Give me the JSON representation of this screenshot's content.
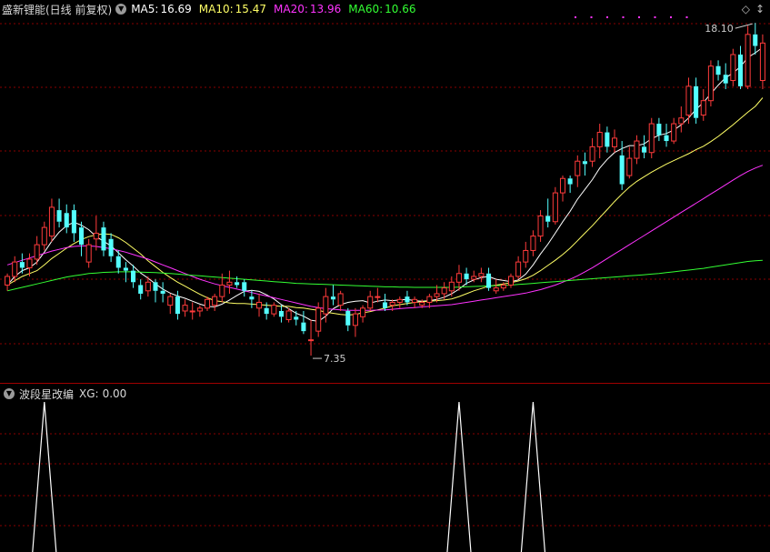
{
  "header": {
    "title": "盛新锂能(日线 前复权)",
    "ma_items": [
      {
        "label": "MA5:",
        "value": "16.69",
        "color": "#ffffff"
      },
      {
        "label": "MA10:",
        "value": "15.47",
        "color": "#ffff66"
      },
      {
        "label": "MA20:",
        "value": "13.96",
        "color": "#ff33ff"
      },
      {
        "label": "MA60:",
        "value": "10.66",
        "color": "#33ff33"
      }
    ]
  },
  "indicator_header": {
    "title": "波段星改编",
    "xg_label": "XG:",
    "xg_value": "0.00"
  },
  "icons": {
    "dropdown": "chevron-down-icon",
    "diamond": "diamond-icon",
    "arrow": "arrow-icon"
  },
  "colors": {
    "up": "#ff3b3b",
    "down": "#54ffff",
    "ma5": "#ffffff",
    "ma10": "#ffff66",
    "ma20": "#ff33ff",
    "ma60": "#33ff33",
    "grid": "#8a0000",
    "xg": "#ffffff"
  },
  "chart_data": {
    "type": "candlestick",
    "ylim": [
      6.5,
      19.0
    ],
    "high_label": "18.10",
    "low_label": "7.35",
    "ohlc": [
      [
        9.8,
        10.2,
        9.6,
        10.1
      ],
      [
        10.1,
        10.8,
        9.9,
        10.6
      ],
      [
        10.6,
        10.9,
        10.2,
        10.4
      ],
      [
        10.4,
        10.9,
        10.1,
        10.7
      ],
      [
        10.7,
        11.5,
        10.5,
        11.2
      ],
      [
        11.2,
        12.0,
        11.0,
        11.8
      ],
      [
        11.5,
        12.8,
        11.3,
        12.5
      ],
      [
        12.4,
        12.8,
        11.8,
        12.0
      ],
      [
        12.3,
        12.6,
        11.6,
        11.8
      ],
      [
        12.4,
        12.6,
        11.3,
        11.6
      ],
      [
        11.8,
        12.0,
        10.8,
        11.2
      ],
      [
        10.6,
        11.4,
        10.4,
        11.2
      ],
      [
        11.4,
        12.2,
        11.0,
        11.6
      ],
      [
        11.8,
        12.0,
        10.8,
        11.0
      ],
      [
        11.4,
        11.6,
        10.6,
        10.8
      ],
      [
        10.8,
        11.0,
        10.2,
        10.4
      ],
      [
        10.4,
        10.6,
        9.9,
        10.3
      ],
      [
        10.3,
        10.5,
        9.7,
        9.9
      ],
      [
        9.8,
        10.0,
        9.3,
        9.5
      ],
      [
        9.6,
        10.1,
        9.4,
        9.9
      ],
      [
        9.9,
        10.0,
        9.2,
        9.6
      ],
      [
        9.6,
        9.9,
        9.2,
        9.5
      ],
      [
        9.1,
        9.5,
        8.8,
        9.4
      ],
      [
        9.4,
        9.6,
        8.6,
        8.8
      ],
      [
        8.9,
        9.3,
        8.7,
        9.1
      ],
      [
        8.9,
        9.2,
        8.6,
        8.9
      ],
      [
        8.9,
        9.1,
        8.7,
        9.0
      ],
      [
        9.0,
        9.4,
        8.9,
        9.3
      ],
      [
        9.1,
        9.5,
        8.9,
        9.4
      ],
      [
        9.4,
        10.2,
        9.2,
        9.8
      ],
      [
        9.8,
        10.3,
        9.5,
        9.9
      ],
      [
        9.9,
        10.1,
        9.7,
        9.8
      ],
      [
        9.9,
        10.0,
        9.4,
        9.6
      ],
      [
        9.4,
        9.6,
        9.0,
        9.3
      ],
      [
        9.0,
        9.5,
        8.7,
        9.2
      ],
      [
        9.0,
        9.2,
        8.6,
        8.8
      ],
      [
        8.8,
        9.2,
        8.7,
        9.1
      ],
      [
        8.9,
        9.1,
        8.5,
        8.7
      ],
      [
        8.6,
        9.0,
        8.5,
        8.9
      ],
      [
        8.7,
        8.9,
        8.4,
        8.6
      ],
      [
        8.5,
        8.9,
        8.1,
        8.2
      ],
      [
        7.9,
        8.6,
        7.35,
        7.9
      ],
      [
        8.2,
        9.2,
        8.0,
        9.0
      ],
      [
        8.8,
        9.7,
        8.5,
        9.4
      ],
      [
        9.4,
        9.8,
        9.1,
        9.3
      ],
      [
        9.1,
        9.6,
        8.9,
        9.5
      ],
      [
        8.9,
        9.0,
        8.2,
        8.4
      ],
      [
        8.4,
        9.0,
        8.0,
        8.8
      ],
      [
        8.7,
        9.1,
        8.5,
        9.0
      ],
      [
        9.0,
        9.6,
        8.9,
        9.4
      ],
      [
        9.4,
        9.7,
        9.2,
        9.4
      ],
      [
        9.2,
        9.5,
        8.9,
        9.0
      ],
      [
        9.1,
        9.3,
        8.9,
        9.2
      ],
      [
        9.2,
        9.4,
        9.0,
        9.3
      ],
      [
        9.4,
        9.6,
        9.1,
        9.2
      ],
      [
        9.2,
        9.4,
        9.0,
        9.3
      ],
      [
        9.1,
        9.3,
        9.0,
        9.2
      ],
      [
        9.2,
        9.5,
        9.0,
        9.4
      ],
      [
        9.4,
        9.8,
        9.2,
        9.5
      ],
      [
        9.5,
        9.9,
        9.3,
        9.7
      ],
      [
        9.6,
        10.1,
        9.4,
        9.9
      ],
      [
        9.9,
        10.5,
        9.6,
        10.2
      ],
      [
        10.2,
        10.4,
        9.8,
        10.0
      ],
      [
        10.0,
        10.3,
        9.9,
        10.1
      ],
      [
        10.1,
        10.4,
        9.9,
        10.2
      ],
      [
        10.2,
        10.4,
        9.6,
        9.7
      ],
      [
        9.6,
        10.0,
        9.5,
        9.7
      ],
      [
        9.7,
        9.9,
        9.6,
        9.8
      ],
      [
        9.8,
        10.2,
        9.7,
        10.1
      ],
      [
        10.1,
        10.8,
        10.0,
        10.6
      ],
      [
        10.6,
        11.3,
        10.4,
        11.0
      ],
      [
        11.0,
        11.7,
        10.8,
        11.5
      ],
      [
        11.5,
        12.4,
        11.3,
        12.2
      ],
      [
        12.2,
        12.8,
        11.8,
        12.0
      ],
      [
        12.0,
        13.2,
        11.9,
        13.0
      ],
      [
        13.0,
        13.6,
        12.7,
        13.5
      ],
      [
        13.5,
        13.6,
        13.0,
        13.3
      ],
      [
        13.6,
        14.3,
        13.2,
        14.1
      ],
      [
        14.1,
        14.4,
        13.6,
        14.0
      ],
      [
        14.1,
        14.9,
        13.9,
        14.6
      ],
      [
        14.6,
        15.4,
        14.2,
        15.1
      ],
      [
        15.1,
        15.3,
        14.4,
        14.6
      ],
      [
        14.6,
        15.2,
        14.4,
        14.9
      ],
      [
        14.3,
        14.8,
        13.1,
        13.3
      ],
      [
        13.6,
        14.6,
        13.5,
        14.2
      ],
      [
        14.2,
        15.0,
        14.0,
        14.8
      ],
      [
        14.6,
        15.0,
        14.2,
        14.4
      ],
      [
        14.4,
        15.6,
        14.2,
        15.4
      ],
      [
        15.4,
        15.6,
        14.8,
        15.0
      ],
      [
        15.0,
        15.4,
        14.6,
        14.8
      ],
      [
        14.8,
        15.6,
        14.7,
        15.4
      ],
      [
        15.4,
        16.0,
        15.1,
        15.6
      ],
      [
        15.7,
        17.0,
        15.4,
        16.7
      ],
      [
        16.7,
        17.0,
        15.4,
        15.6
      ],
      [
        15.7,
        16.6,
        15.5,
        16.2
      ],
      [
        16.2,
        17.6,
        16.0,
        17.4
      ],
      [
        17.4,
        17.6,
        16.9,
        17.1
      ],
      [
        17.1,
        17.5,
        16.6,
        16.8
      ],
      [
        16.9,
        18.0,
        16.7,
        17.8
      ],
      [
        17.8,
        18.1,
        16.6,
        16.7
      ],
      [
        16.7,
        18.8,
        16.6,
        18.5
      ],
      [
        18.5,
        18.9,
        17.8,
        18.1
      ],
      [
        16.9,
        18.5,
        16.6,
        18.2
      ]
    ],
    "series": [
      {
        "name": "MA5",
        "values": [
          9.8,
          10.1,
          10.3,
          10.4,
          10.6,
          10.94,
          11.32,
          11.64,
          11.86,
          11.98,
          11.88,
          11.72,
          11.48,
          11.32,
          11.16,
          10.92,
          10.68,
          10.46,
          10.22,
          10.04,
          9.84,
          9.66,
          9.52,
          9.42,
          9.34,
          9.24,
          9.14,
          9.06,
          9.04,
          9.14,
          9.28,
          9.44,
          9.58,
          9.62,
          9.58,
          9.46,
          9.32,
          9.12,
          8.98,
          8.82,
          8.72,
          8.58,
          8.54,
          8.72,
          8.98,
          9.12,
          9.2,
          9.24,
          9.26,
          9.18,
          9.24,
          9.28,
          9.26,
          9.28,
          9.3,
          9.26,
          9.24,
          9.26,
          9.3,
          9.38,
          9.5,
          9.66,
          9.86,
          9.98,
          10.06,
          10.1,
          10.0,
          9.96,
          9.92,
          9.98,
          10.18,
          10.5,
          10.88,
          11.22,
          11.6,
          12.0,
          12.36,
          12.78,
          13.12,
          13.46,
          13.86,
          14.16,
          14.4,
          14.54,
          14.64,
          14.64,
          14.7,
          14.88,
          15.0,
          15.06,
          15.18,
          15.36,
          15.6,
          15.9,
          16.14,
          16.44,
          16.74,
          17.0,
          17.16,
          17.38,
          17.7,
          17.86,
          18.05
        ]
      },
      {
        "name": "MA10",
        "values": [
          9.8,
          9.95,
          10.1,
          10.2,
          10.3,
          10.5,
          10.72,
          10.9,
          11.08,
          11.24,
          11.38,
          11.48,
          11.54,
          11.58,
          11.56,
          11.44,
          11.28,
          11.08,
          10.88,
          10.64,
          10.44,
          10.24,
          10.06,
          9.9,
          9.76,
          9.62,
          9.48,
          9.36,
          9.26,
          9.22,
          9.18,
          9.16,
          9.16,
          9.14,
          9.12,
          9.1,
          9.08,
          9.06,
          9.06,
          9.02,
          9.0,
          8.96,
          8.92,
          8.86,
          8.82,
          8.78,
          8.76,
          8.78,
          8.84,
          8.88,
          8.94,
          9.0,
          9.08,
          9.12,
          9.16,
          9.2,
          9.22,
          9.24,
          9.26,
          9.28,
          9.32,
          9.4,
          9.5,
          9.6,
          9.68,
          9.76,
          9.8,
          9.84,
          9.88,
          9.94,
          10.02,
          10.14,
          10.3,
          10.48,
          10.66,
          10.86,
          11.08,
          11.34,
          11.6,
          11.86,
          12.14,
          12.42,
          12.7,
          12.96,
          13.2,
          13.4,
          13.56,
          13.72,
          13.86,
          14.0,
          14.12,
          14.24,
          14.36,
          14.5,
          14.62,
          14.78,
          14.96,
          15.16,
          15.36,
          15.58,
          15.8,
          16.0,
          16.3
        ]
      },
      {
        "name": "MA20",
        "values": [
          10.5,
          10.58,
          10.66,
          10.74,
          10.82,
          10.9,
          10.98,
          11.04,
          11.1,
          11.14,
          11.16,
          11.16,
          11.14,
          11.1,
          11.06,
          11.0,
          10.94,
          10.86,
          10.78,
          10.7,
          10.6,
          10.5,
          10.4,
          10.3,
          10.2,
          10.1,
          10.0,
          9.92,
          9.84,
          9.78,
          9.72,
          9.66,
          9.6,
          9.54,
          9.48,
          9.42,
          9.36,
          9.3,
          9.24,
          9.18,
          9.12,
          9.06,
          9.02,
          8.98,
          8.96,
          8.94,
          8.92,
          8.92,
          8.92,
          8.92,
          8.93,
          8.94,
          8.96,
          8.98,
          9.0,
          9.02,
          9.04,
          9.06,
          9.08,
          9.1,
          9.12,
          9.16,
          9.2,
          9.24,
          9.28,
          9.32,
          9.36,
          9.4,
          9.44,
          9.48,
          9.52,
          9.58,
          9.64,
          9.72,
          9.8,
          9.9,
          10.0,
          10.12,
          10.26,
          10.4,
          10.56,
          10.72,
          10.88,
          11.04,
          11.2,
          11.36,
          11.52,
          11.68,
          11.84,
          12.0,
          12.16,
          12.32,
          12.48,
          12.64,
          12.8,
          12.96,
          13.12,
          13.28,
          13.44,
          13.6,
          13.74,
          13.86,
          13.96
        ]
      },
      {
        "name": "MA60",
        "values": [
          9.6,
          9.66,
          9.72,
          9.78,
          9.84,
          9.9,
          9.96,
          10.02,
          10.08,
          10.12,
          10.16,
          10.2,
          10.22,
          10.24,
          10.25,
          10.26,
          10.26,
          10.26,
          10.25,
          10.24,
          10.23,
          10.22,
          10.2,
          10.18,
          10.16,
          10.14,
          10.12,
          10.1,
          10.08,
          10.06,
          10.04,
          10.02,
          10.0,
          9.98,
          9.96,
          9.94,
          9.92,
          9.9,
          9.88,
          9.86,
          9.85,
          9.84,
          9.83,
          9.82,
          9.81,
          9.8,
          9.79,
          9.78,
          9.77,
          9.76,
          9.75,
          9.74,
          9.74,
          9.73,
          9.73,
          9.72,
          9.72,
          9.72,
          9.72,
          9.72,
          9.72,
          9.73,
          9.74,
          9.75,
          9.76,
          9.77,
          9.78,
          9.79,
          9.8,
          9.82,
          9.84,
          9.86,
          9.88,
          9.9,
          9.92,
          9.94,
          9.96,
          9.98,
          10.0,
          10.02,
          10.04,
          10.06,
          10.08,
          10.1,
          10.12,
          10.14,
          10.16,
          10.18,
          10.2,
          10.23,
          10.26,
          10.29,
          10.32,
          10.35,
          10.38,
          10.42,
          10.46,
          10.5,
          10.54,
          10.58,
          10.62,
          10.64,
          10.66
        ]
      }
    ],
    "xg_signals": [
      {
        "index": 5,
        "value": 1
      },
      {
        "index": 61,
        "value": 1
      },
      {
        "index": 71,
        "value": 1
      }
    ]
  }
}
